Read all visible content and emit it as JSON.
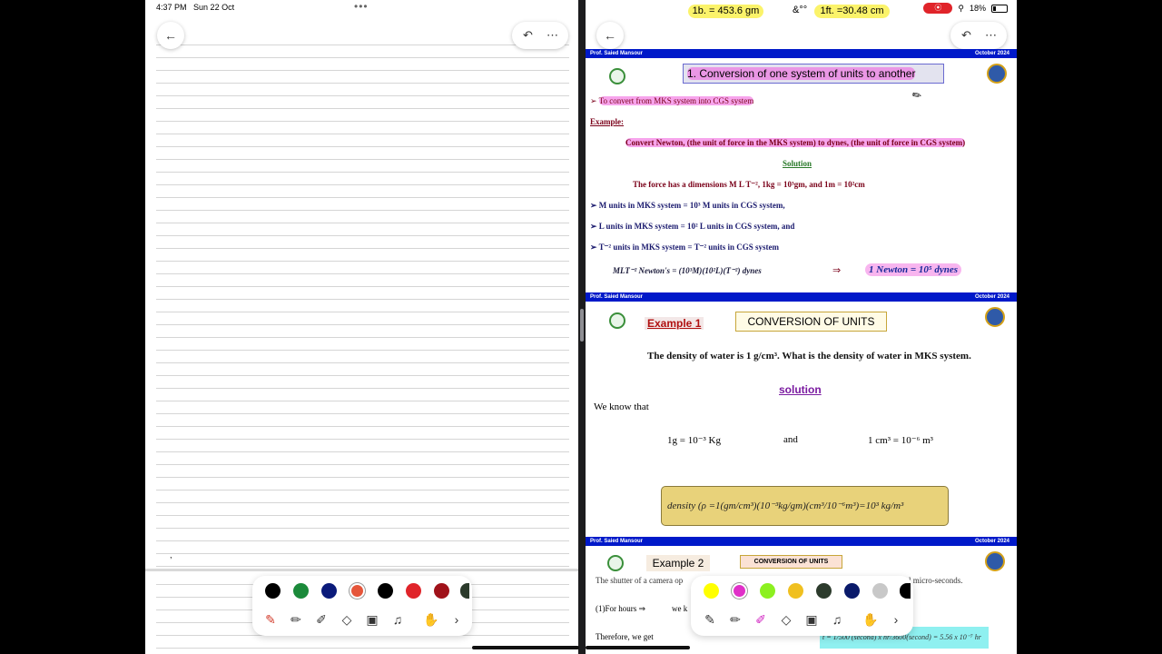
{
  "status": {
    "time": "4:37 PM",
    "date": "Sun 22 Oct",
    "battery": "18%"
  },
  "highlights": {
    "lb": "1b. = 453.6 gm",
    "amp": "&°°",
    "ft": "1ft. =30.48 cm"
  },
  "slide1": {
    "author": "Prof. Saied Mansour",
    "date": "October 2024",
    "title": "1. Conversion of one system of units to another",
    "bullet": "To convert from MKS system into CGS system",
    "example_label": "Example:",
    "prompt": "Convert Newton, (the unit of force in the MKS system) to dynes, (the unit of force in CGS system)",
    "solution_label": "Solution",
    "dims": "The force has a dimensions M L T⁻²,      1kg = 10³gm,   and    1m = 10²cm",
    "b1": "M units in MKS system = 10³ M units in CGS system,",
    "b2": "L units in MKS system = 10² L units in CGS system, and",
    "b3": "T⁻² units in MKS system = T⁻² units in CGS system",
    "eq": "MLT⁻² Newton's = (10³M)(10²L)(T⁻²) dynes",
    "arrow": "⇒",
    "result": "1 Newton = 10⁵ dynes"
  },
  "slide2": {
    "author": "Prof. Saied Mansour",
    "date": "October 2024",
    "example": "Example 1",
    "title": "CONVERSION OF UNITS",
    "question": "The density of water is 1 g/cm³. What is the density of water in MKS system.",
    "solution": "solution",
    "know": "We know that",
    "g": "1g = 10⁻³ Kg",
    "and": "and",
    "cm": "1 cm³ = 10⁻⁶ m³",
    "density": "density (ρ =1(gm/cm³)(10⁻³kg/gm)(cm³/10⁻⁶m³)=10³ kg/m³"
  },
  "slide3": {
    "author": "Prof. Saied Mansour",
    "date": "October 2024",
    "example": "Example 2",
    "title": "CONVERSION OF UNITS",
    "line1a": "The shutter of a camera op",
    "line1b": "l micro-seconds.",
    "line2a": "(1)For hours  ⇒",
    "line2b": "we k",
    "line3": "Therefore, we get",
    "formula": "t = 1/500 (second) x hr/3600(second) = 5.56 x 10⁻⁷ hr"
  }
}
